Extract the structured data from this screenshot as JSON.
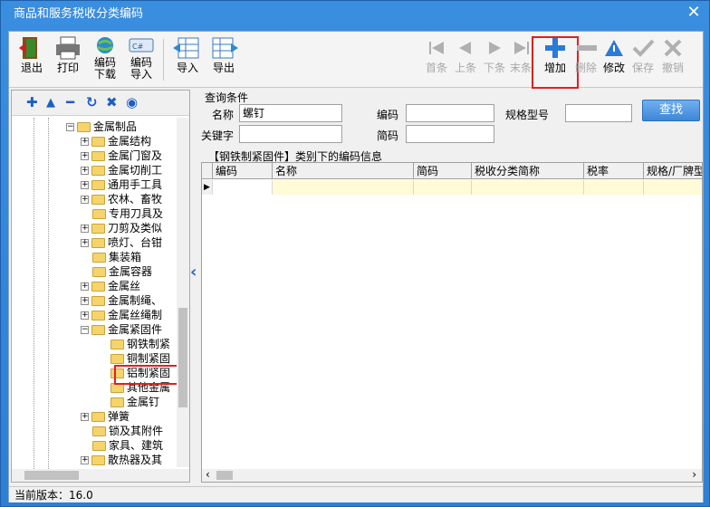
{
  "window": {
    "title": "商品和服务税收分类编码",
    "close_glyph": "✕"
  },
  "toolbar": {
    "exit": "退出",
    "print": "打印",
    "code_download_1": "编码",
    "code_download_2": "下载",
    "code_import_1": "编码",
    "code_import_2": "导入",
    "import": "导入",
    "export": "导出",
    "first": "首条",
    "prev": "上条",
    "next": "下条",
    "last": "末条",
    "add": "增加",
    "delete": "删除",
    "modify": "修改",
    "save": "保存",
    "undo": "撤销"
  },
  "tree_tools": {
    "add": "✚",
    "up": "▲",
    "remove": "━",
    "refresh": "↻",
    "expand": "✖",
    "locate": "◉"
  },
  "tree": {
    "root": "金属制品",
    "items": [
      "金属结构",
      "金属门窗及",
      "金属切削工",
      "通用手工具",
      "农林、畜牧",
      "专用刀具及",
      "刀剪及类似",
      "喷灯、台钳",
      "集装箱",
      "金属容器",
      "金属丝",
      "金属制绳、",
      "金属丝绳制",
      "金属紧固件"
    ],
    "children": [
      "钢铁制紧",
      "铜制紧固",
      "铝制紧固",
      "其他金属",
      "金属钉"
    ],
    "after": [
      "弹簧",
      "锁及其附件",
      "家具、建筑",
      "散热器及其"
    ]
  },
  "query": {
    "section_label": "查询条件",
    "name_label": "名称",
    "name_value": "螺钉",
    "code_label": "编码",
    "code_value": "",
    "spec_label": "规格型号",
    "spec_value": "",
    "keyword_label": "关键字",
    "keyword_value": "",
    "short_code_label": "简码",
    "short_code_value": "",
    "find_button": "查找"
  },
  "grid": {
    "caption": "【钢铁制紧固件】类别下的编码信息",
    "columns": [
      "编码",
      "名称",
      "简码",
      "税收分类简称",
      "税率",
      "规格/厂牌型"
    ]
  },
  "status": {
    "version": "当前版本：16.0"
  }
}
